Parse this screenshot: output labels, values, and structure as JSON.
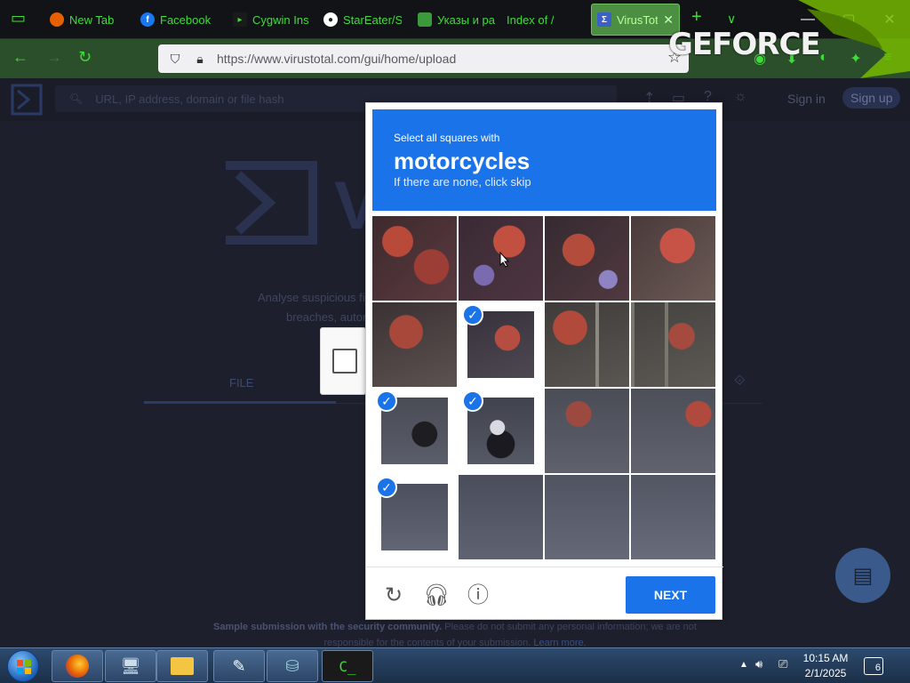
{
  "browser": {
    "tabs": [
      {
        "label": "New Tab",
        "icon": "firefox-icon",
        "color": "#e66000"
      },
      {
        "label": "Facebook",
        "icon": "facebook-icon",
        "color": "#1877f2"
      },
      {
        "label": "Cygwin Ins",
        "icon": "cygwin-icon",
        "color": "#1a1a1a"
      },
      {
        "label": "StarEater/S",
        "icon": "github-icon",
        "color": "#222222"
      },
      {
        "label": "Указы и ра",
        "icon": "shield-emblem-icon",
        "color": "#3c9a3c"
      },
      {
        "label": "Index of /",
        "icon": "",
        "color": ""
      },
      {
        "label": "VirusTot",
        "icon": "virustotal-icon",
        "color": "#3b61c9"
      }
    ],
    "url": "https://www.virustotal.com/gui/home/upload",
    "theme_accent": "#3ddc39"
  },
  "overlay": {
    "text": "GEFORCE"
  },
  "vt": {
    "search_placeholder": "URL, IP address, domain or file hash",
    "sign_in": "Sign in",
    "sign_up": "Sign up",
    "big_logo_text": "VI",
    "desc_line1": "Analyse suspicious fi",
    "desc_line2": "breaches, autor",
    "file_tab": "FILE",
    "footer_line1": "By submitting data above, you are ag",
    "footer_line2_bold": "Sample submission with the security community.",
    "footer_line2_rest": "Please do not submit any personal information; we are not",
    "footer_line3": "responsible for the contents of your submission.",
    "learn_more": "Learn more."
  },
  "captcha": {
    "intro": "Select all squares with",
    "object": "motorcycles",
    "subtext": "If there are none, click skip",
    "rows": 4,
    "cols": 4,
    "selected": [
      [
        1,
        1
      ],
      [
        2,
        0
      ],
      [
        2,
        1
      ],
      [
        3,
        0
      ]
    ],
    "next_label": "NEXT",
    "accent": "#1a73e8"
  },
  "taskbar": {
    "items": [
      "firefox-icon",
      "computer-icon",
      "folder-icon",
      "pen-icon",
      "drive-icon",
      "cygwin-terminal-icon"
    ],
    "time": "10:15 AM",
    "date": "2/1/2025",
    "notification_count": "6"
  }
}
